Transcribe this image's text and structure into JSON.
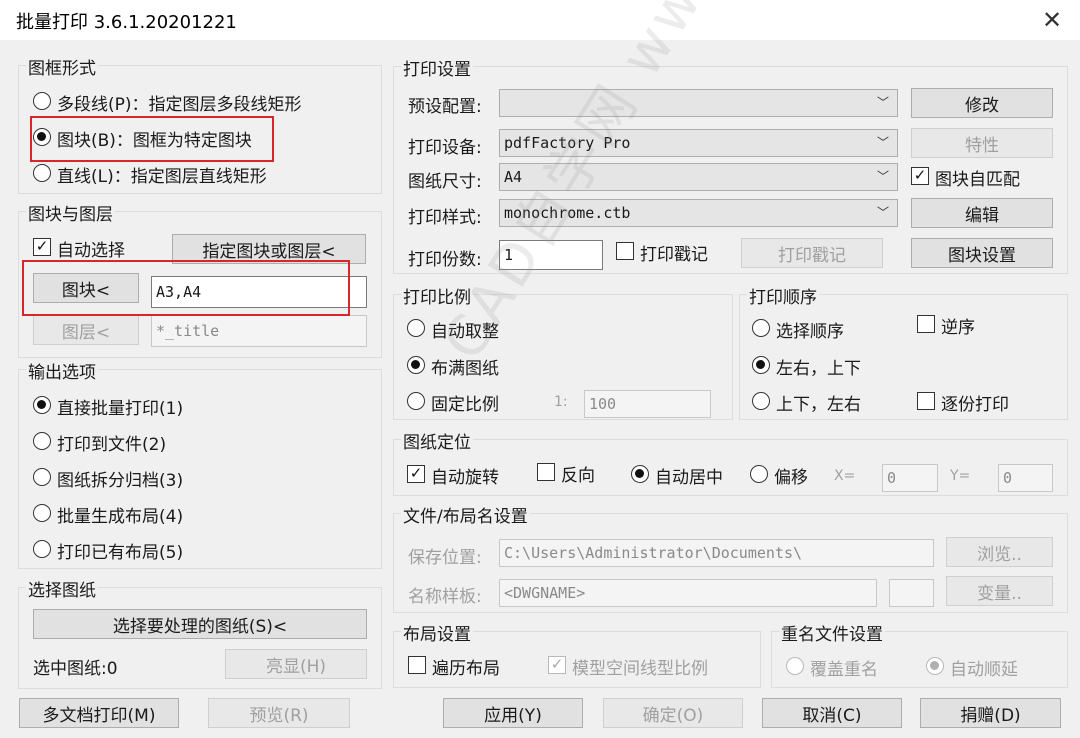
{
  "window": {
    "title": "批量打印 3.6.1.20201221",
    "close": "✕"
  },
  "frame_form": {
    "title": "图框形式",
    "options": [
      {
        "label": "多段线(P)：指定图层多段线矩形",
        "selected": false
      },
      {
        "label": "图块(B)：图框为特定图块",
        "selected": true
      },
      {
        "label": "直线(L)：指定图层直线矩形",
        "selected": false
      }
    ]
  },
  "block_layer": {
    "title": "图块与图层",
    "auto_select_label": "自动选择",
    "assign_button": "指定图块或图层<",
    "block_button": "图块<",
    "block_value": "A3,A4",
    "layer_button": "图层<",
    "layer_value": "*_title"
  },
  "output": {
    "title": "输出选项",
    "options": [
      {
        "label": "直接批量打印(1)",
        "selected": true
      },
      {
        "label": "打印到文件(2)",
        "selected": false
      },
      {
        "label": "图纸拆分归档(3)",
        "selected": false
      },
      {
        "label": "批量生成布局(4)",
        "selected": false
      },
      {
        "label": "打印已有布局(5)",
        "selected": false
      }
    ]
  },
  "select_sheets": {
    "title": "选择图纸",
    "select_button": "选择要处理的图纸(S)<",
    "selected_count_label": "选中图纸:0",
    "highlight_button": "亮显(H)"
  },
  "print_settings": {
    "title": "打印设置",
    "preset_label": "预设配置:",
    "preset_value": "",
    "modify_button": "修改",
    "device_label": "打印设备:",
    "device_value": "pdfFactory Pro",
    "properties_button": "特性",
    "paper_label": "图纸尺寸:",
    "paper_value": "A4",
    "block_match_label": "图块自匹配",
    "style_label": "打印样式:",
    "style_value": "monochrome.ctb",
    "edit_button": "编辑",
    "copies_label": "打印份数:",
    "copies_value": "1",
    "stamp_check_label": "打印戳记",
    "stamp_button": "打印戳记",
    "block_settings_button": "图块设置"
  },
  "scale": {
    "title": "打印比例",
    "auto_label": "自动取整",
    "fit_label": "布满图纸",
    "fixed_label": "固定比例",
    "ratio_prefix": "1:",
    "ratio_value": "100",
    "selected": "fit"
  },
  "order": {
    "title": "打印顺序",
    "select_order_label": "选择顺序",
    "reverse_label": "逆序",
    "lr_tb_label": "左右，上下",
    "tb_lr_label": "上下，左右",
    "collate_label": "逐份打印",
    "selected": "lr_tb"
  },
  "positioning": {
    "title": "图纸定位",
    "auto_rotate_label": "自动旋转",
    "reverse_label": "反向",
    "auto_center_label": "自动居中",
    "offset_label": "偏移",
    "x_label": "X=",
    "x_value": "0",
    "y_label": "Y=",
    "y_value": "0"
  },
  "file_naming": {
    "title": "文件/布局名设置",
    "save_location_label": "保存位置:",
    "save_location_value": "C:\\Users\\Administrator\\Documents\\",
    "browse_button": "浏览..",
    "name_pattern_label": "名称样板:",
    "name_pattern_value": "<DWGNAME>",
    "variable_button": "变量.."
  },
  "layout": {
    "title": "布局设置",
    "traverse_label": "遍历布局",
    "model_linetype_label": "模型空间线型比例"
  },
  "rename": {
    "title": "重名文件设置",
    "overwrite_label": "覆盖重名",
    "auto_increment_label": "自动顺延"
  },
  "footer": {
    "multi_doc_button": "多文档打印(M)",
    "preview_button": "预览(R)",
    "apply_button": "应用(Y)",
    "ok_button": "确定(O)",
    "cancel_button": "取消(C)",
    "donate_button": "捐赠(D)"
  },
  "watermark": "CAD自学网 www.cadzxw.com",
  "colors": {
    "highlight_box": "#d9262c",
    "background": "#f0f0f0"
  }
}
